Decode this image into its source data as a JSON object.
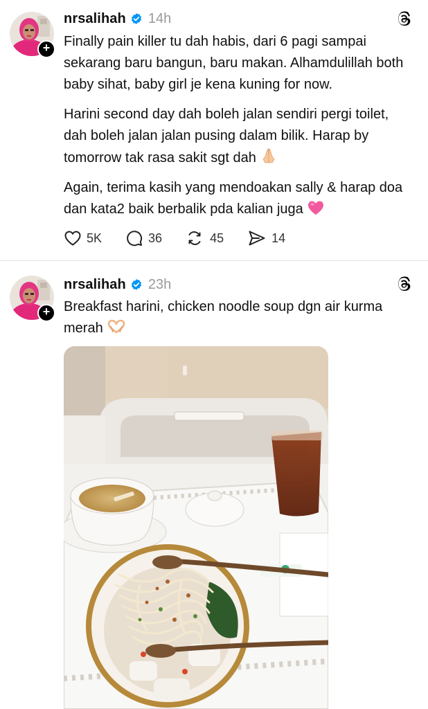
{
  "posts": [
    {
      "username": "nrsalihah",
      "time": "14h",
      "paragraphs": [
        "Finally pain killer tu dah habis, dari 6 pagi sampai sekarang baru bangun, baru makan. Alhamdulillah both baby sihat, baby girl je kena kuning for now.",
        "Harini second day dah boleh jalan sendiri pergi toilet, dah boleh jalan jalan pusing dalam bilik. Harap by tomorrow tak rasa sakit sgt dah",
        "Again, terima kasih yang mendoakan sally & harap doa dan kata2 baik berbalik pda kalian juga"
      ],
      "emojis": [
        "folded-hands",
        "pink-heart"
      ],
      "stats": {
        "likes": "5K",
        "replies": "36",
        "reposts": "45",
        "shares": "14"
      }
    },
    {
      "username": "nrsalihah",
      "time": "23h",
      "text": "Breakfast harini, chicken noodle soup dgn air kurma merah",
      "emoji": "heart-hands",
      "image": "photo of hospital breakfast tray with noodle soup, tea and date juice"
    }
  ],
  "icons": {
    "verified": "verified-badge-icon",
    "threads": "threads-logo-icon",
    "like": "heart-icon",
    "reply": "comment-icon",
    "repost": "repost-icon",
    "share": "send-icon",
    "follow": "plus-icon"
  },
  "colors": {
    "verified": "#0095f6",
    "meta": "#999999",
    "text": "#101010",
    "heart_emoji": "#f25aa0"
  }
}
